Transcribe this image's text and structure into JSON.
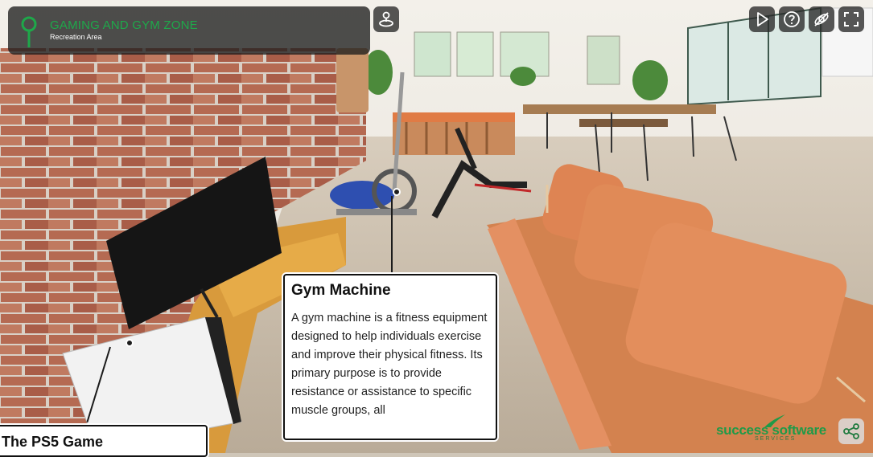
{
  "header": {
    "location_title": "GAMING AND GYM ZONE",
    "location_subtitle": "Recreation Area"
  },
  "toolbar": {
    "buttons": [
      {
        "name": "map-joystick-button",
        "icon": "joystick-map-icon"
      },
      {
        "name": "play-button",
        "icon": "play-icon"
      },
      {
        "name": "help-button",
        "icon": "question-icon"
      },
      {
        "name": "gyroscope-toggle-button",
        "icon": "gyroscope-off-icon"
      },
      {
        "name": "fullscreen-button",
        "icon": "fullscreen-icon"
      }
    ]
  },
  "hotspots": {
    "gym": {
      "title": "Gym Machine",
      "description": "A gym machine is a fitness equipment designed to help individuals exercise and improve their physical fitness. Its primary purpose is to provide resistance or assistance to specific muscle groups, all"
    },
    "ps5": {
      "title": "The PS5 Game"
    }
  },
  "branding": {
    "logo_text": "success software",
    "logo_sub": "SERVICES",
    "share_icon": "share-icon"
  },
  "colors": {
    "accent_green": "#1ea84a",
    "panel_bg": "#1e1e1e"
  }
}
